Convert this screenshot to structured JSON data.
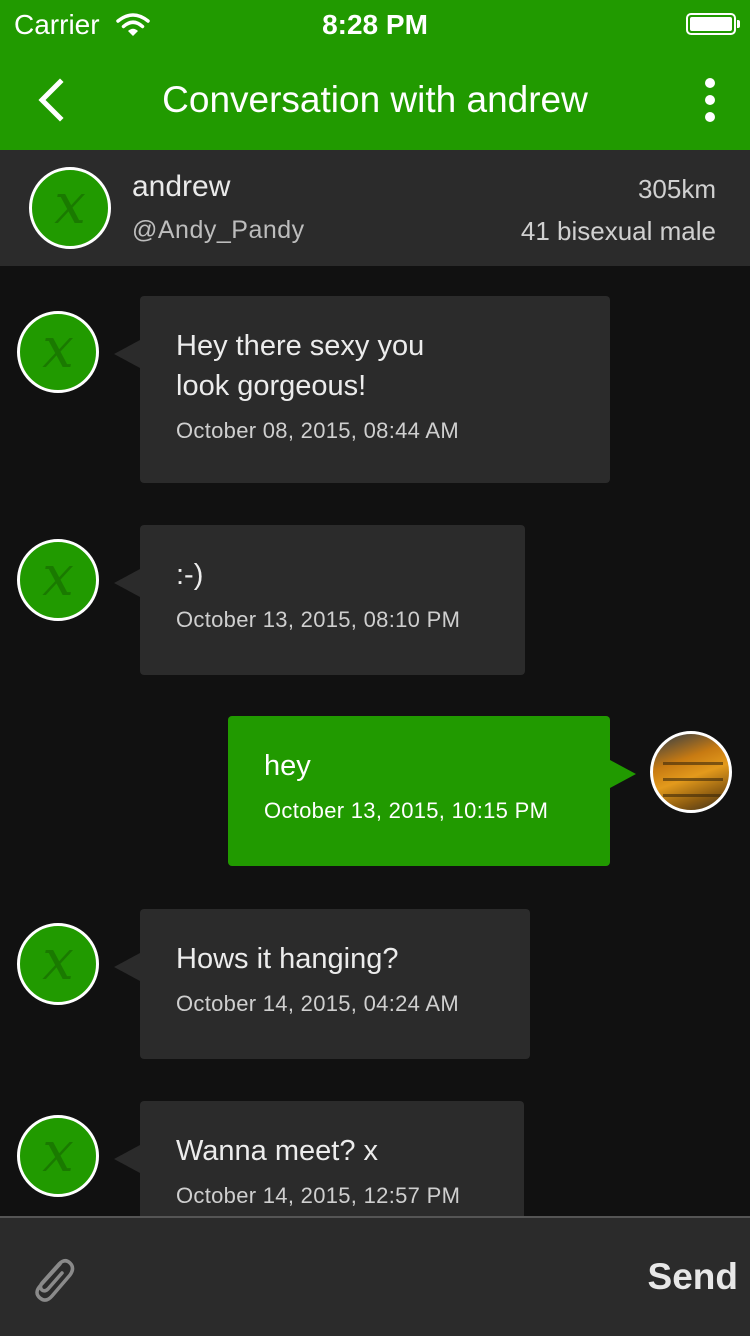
{
  "status_bar": {
    "carrier": "Carrier",
    "time": "8:28 PM",
    "battery_level": 1.0
  },
  "nav": {
    "title": "Conversation with andrew",
    "back_icon": "chevron-left-icon",
    "more_icon": "more-vertical-icon"
  },
  "profile": {
    "name": "andrew",
    "handle": "@Andy_Pandy",
    "distance": "305km",
    "info": "41 bisexual male"
  },
  "messages": [
    {
      "direction": "incoming",
      "text": "Hey there sexy you look gorgeous!",
      "time": "October 08, 2015, 08:44 AM"
    },
    {
      "direction": "incoming",
      "text": ":-)",
      "time": "October 13, 2015, 08:10 PM"
    },
    {
      "direction": "outgoing",
      "text": "hey",
      "time": "October 13, 2015, 10:15 PM"
    },
    {
      "direction": "incoming",
      "text": "Hows it hanging?",
      "time": "October 14, 2015, 04:24 AM"
    },
    {
      "direction": "incoming",
      "text": "Wanna meet? x",
      "time": "October 14, 2015, 12:57 PM"
    }
  ],
  "composer": {
    "attach_icon": "paperclip-icon",
    "send_label": "Send"
  },
  "colors": {
    "accent": "#219a00",
    "background": "#111111",
    "bubble": "#2b2b2b"
  }
}
